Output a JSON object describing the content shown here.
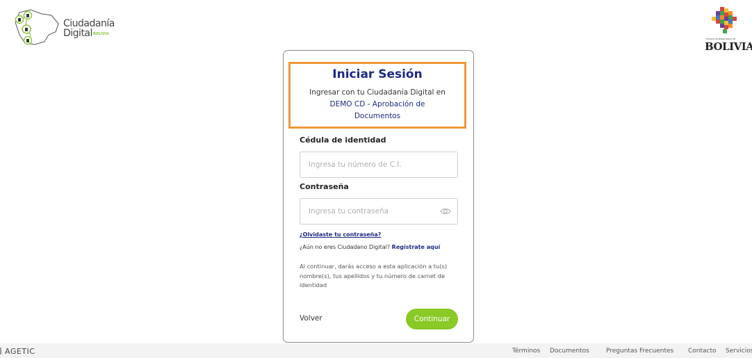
{
  "header": {
    "cd_logo": {
      "line1": "Ciudadanía",
      "line2": "Digital",
      "badge": "BOLIVIA",
      "icon": "bolivia-map-network-icon"
    },
    "gov_logo": {
      "caption": "ESTADO PLURINACIONAL DE",
      "word": "BOLIVIA",
      "icon": "bolivia-coat-of-arms-icon"
    }
  },
  "login": {
    "title": "Iniciar Sesión",
    "subtitle_prefix": "Ingresar con tu Ciudadanía Digital en",
    "app_name": "DEMO CD - Aprobación de Documentos",
    "ci_label": "Cédula de identidad",
    "ci_placeholder": "Ingresa tu número de C.I.",
    "ci_value": "",
    "pass_label": "Contraseña",
    "pass_placeholder": "Ingresa tu contraseña",
    "pass_value": "",
    "forgot": "¿Olvidaste tu contraseña?",
    "not_citizen": "¿Aún no eres Ciudadano Digital?",
    "register": "Regístrate aquí",
    "notice": "Al continuar, darás acceso a esta aplicación a tu(s) nombre(s), tus apellidos y tu número de carnet de identidad",
    "back": "Volver",
    "continue": "Continuar"
  },
  "footer": {
    "brand": "AGETIC",
    "links": [
      "Términos",
      "Documentos",
      "Preguntas Frecuentes",
      "Contacto",
      "Servicios"
    ]
  },
  "colors": {
    "primary": "#1c2a85",
    "accent_green": "#8ac926",
    "highlight": "#f0973c"
  }
}
